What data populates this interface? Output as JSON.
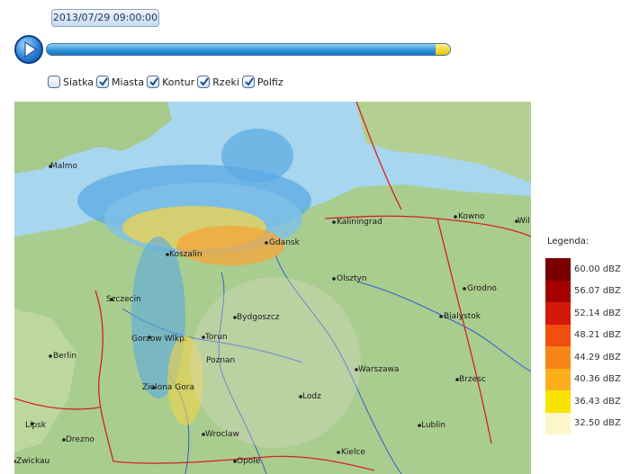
{
  "timestamp": "2013/07/29 09:00:00",
  "playback": {
    "progress": 0.965
  },
  "layers": [
    {
      "label": "Siatka",
      "checked": false
    },
    {
      "label": "Miasta",
      "checked": true
    },
    {
      "label": "Kontur",
      "checked": true
    },
    {
      "label": "Rzeki",
      "checked": true
    },
    {
      "label": "Polfiz",
      "checked": true
    }
  ],
  "legend": {
    "title": "Legenda:",
    "items": [
      {
        "label": "60.00 dBZ",
        "color": "#7a0000"
      },
      {
        "label": "56.07 dBZ",
        "color": "#a50000"
      },
      {
        "label": "52.14 dBZ",
        "color": "#d21a0a"
      },
      {
        "label": "48.21 dBZ",
        "color": "#f24e10"
      },
      {
        "label": "44.29 dBZ",
        "color": "#f98418"
      },
      {
        "label": "40.36 dBZ",
        "color": "#fcae1c"
      },
      {
        "label": "36.43 dBZ",
        "color": "#f9e100"
      },
      {
        "label": "32.50 dBZ",
        "color": "#fbf7c8"
      }
    ]
  },
  "map": {
    "cities": [
      "Malmo",
      "Kaliningrad",
      "Kowno",
      "Wil",
      "Koszalin",
      "Gdansk",
      "Olsztyn",
      "Grodno",
      "Szczecin",
      "Bydgoszcz",
      "Torun",
      "Bialystok",
      "Gorzow Wlkp.",
      "Berlin",
      "Poznan",
      "Warszawa",
      "Brzesc",
      "Zielona Gora",
      "Lodz",
      "Lipsk",
      "Drezno",
      "Wroclaw",
      "Lublin",
      "Zwickau",
      "Opole",
      "Kielce"
    ]
  }
}
